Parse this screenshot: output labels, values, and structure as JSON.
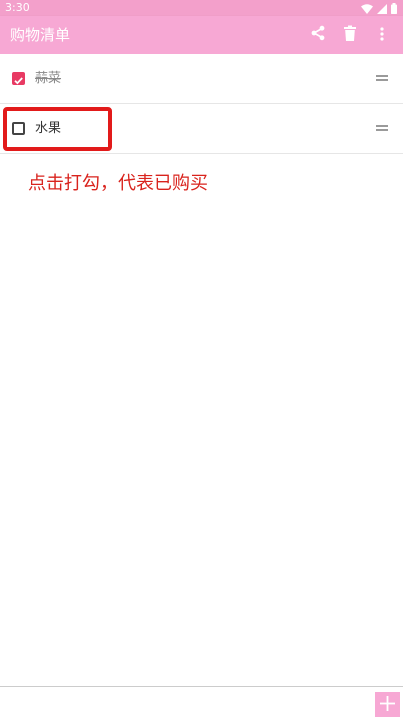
{
  "status_bar": {
    "time": "3:30",
    "icons": [
      "wifi-icon",
      "cell-signal-icon",
      "battery-icon"
    ]
  },
  "app_bar": {
    "title": "购物清单",
    "actions": [
      "share-icon",
      "delete-icon",
      "more-icon"
    ],
    "color": "#f7a8d4"
  },
  "list": {
    "items": [
      {
        "label": "蒜菜",
        "checked": true
      },
      {
        "label": "水果",
        "checked": false
      }
    ]
  },
  "annotation": {
    "hint": "点击打勾，代表已购买",
    "color": "#e21a1a"
  },
  "bottom_bar": {
    "input_value": "",
    "add_icon": "plus-icon"
  },
  "colors": {
    "accent": "#f7a8d4",
    "checkbox_checked": "#e83a63",
    "annotation_red": "#d9231d"
  }
}
